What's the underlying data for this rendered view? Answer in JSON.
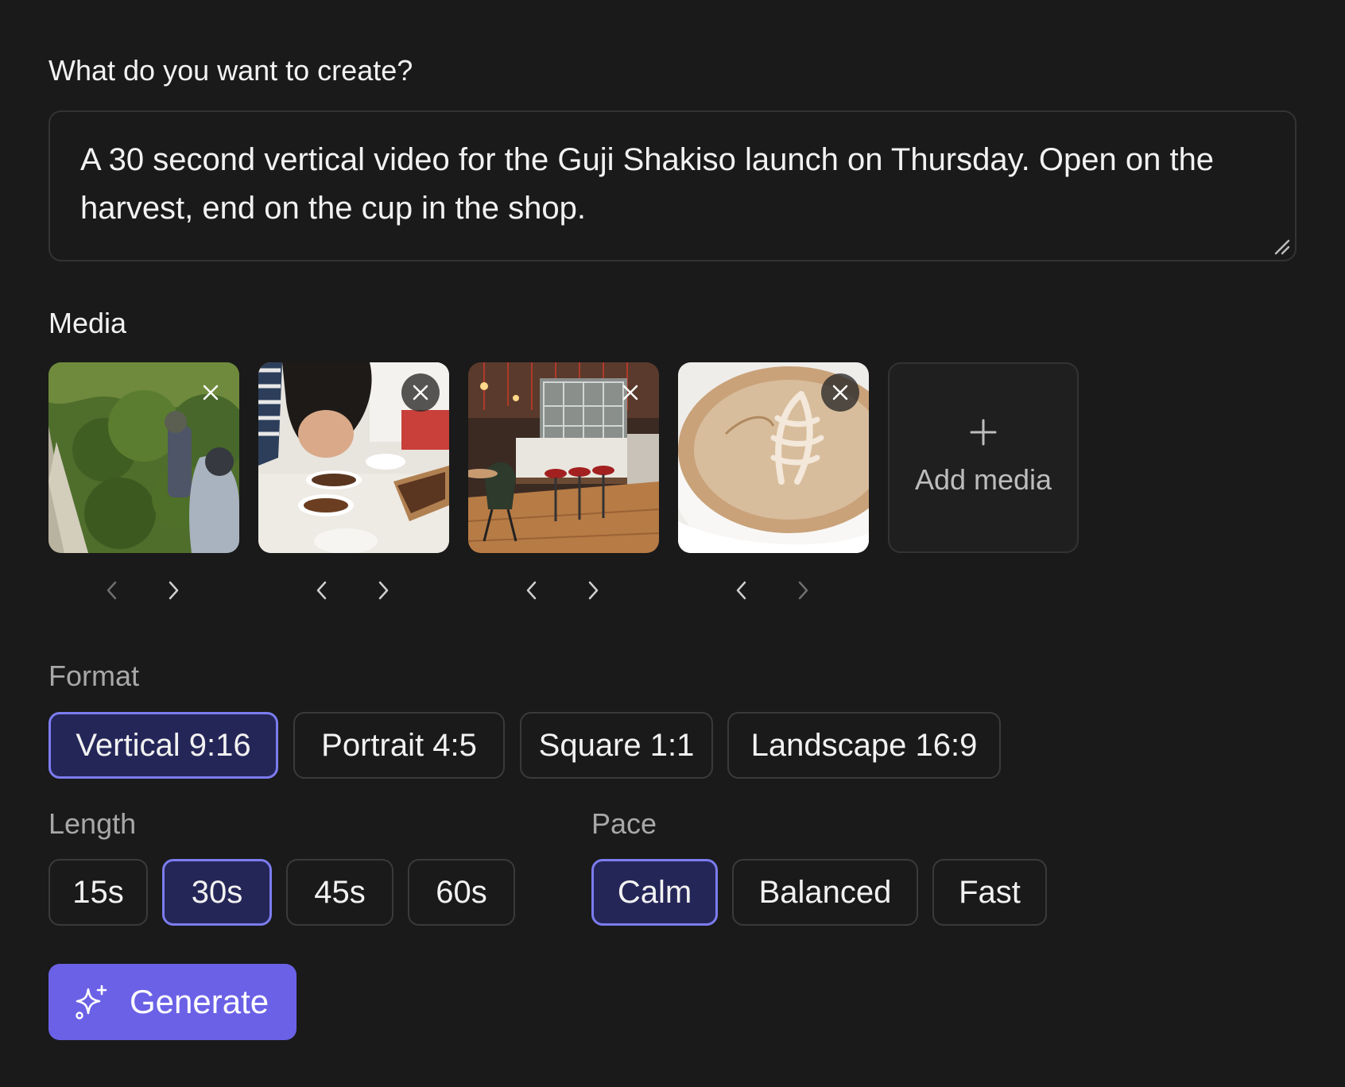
{
  "prompt": {
    "label": "What do you want to create?",
    "value": "A 30 second vertical video for the Guji Shakiso launch on Thursday. Open on the harvest, end on the cup in the shop."
  },
  "media": {
    "label": "Media",
    "add_label": "Add media",
    "items": [
      {
        "subject": "coffee harvest photo"
      },
      {
        "subject": "coffee cupping photo"
      },
      {
        "subject": "coffee shop interior photo"
      },
      {
        "subject": "latte art cup photo"
      }
    ]
  },
  "format": {
    "label": "Format",
    "options": [
      "Vertical 9:16",
      "Portrait 4:5",
      "Square 1:1",
      "Landscape 16:9"
    ],
    "selected": "Vertical 9:16"
  },
  "length": {
    "label": "Length",
    "options": [
      "15s",
      "30s",
      "45s",
      "60s"
    ],
    "selected": "30s"
  },
  "pace": {
    "label": "Pace",
    "options": [
      "Calm",
      "Balanced",
      "Fast"
    ],
    "selected": "Calm"
  },
  "generate": {
    "label": "Generate",
    "icon": "sparkles-icon"
  },
  "colors": {
    "background": "#1a1a1a",
    "accent": "#6b61e6",
    "selected_fill": "#252658",
    "selected_border": "#7c7cf0"
  }
}
